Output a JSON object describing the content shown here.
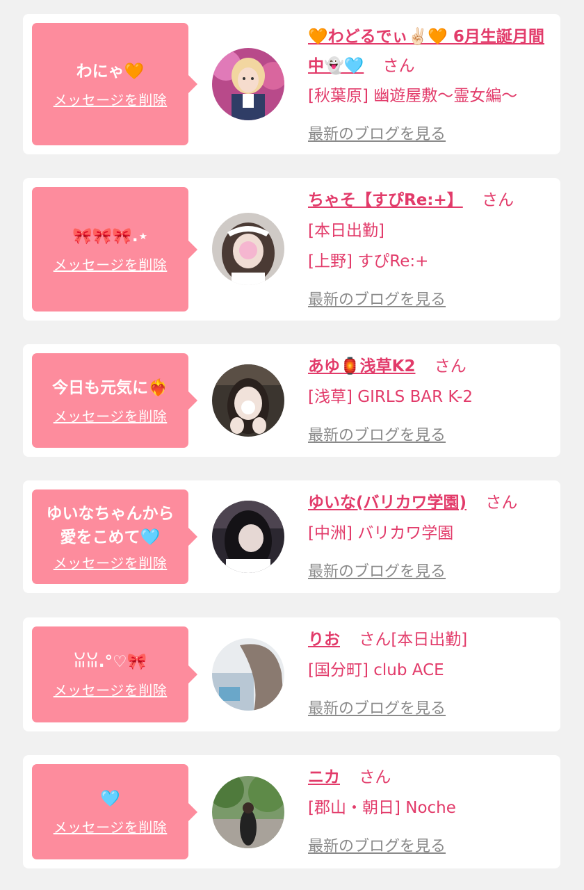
{
  "delete_label": "メッセージを削除",
  "blog_label": "最新のブログを見る",
  "honorific": "さん",
  "colors": {
    "bubble": "#fd8c9d",
    "accent": "#e23b6a",
    "link_gray": "#8a8a8a",
    "card": "#ffffff",
    "background": "#f1f1f1"
  },
  "entries": [
    {
      "message": "わにゃ🧡",
      "name": "🧡わどるでぃ✌🏻🧡 6月生誕月間中👻🩵",
      "details": [
        "[秋葉原] 幽遊屋敷〜霊女編〜"
      ],
      "avatar": "avatar-pink-costume"
    },
    {
      "message": "🎀🎀🎀.⋆",
      "name": "ちゃそ【すぴRe:+】",
      "details": [
        "[本日出勤]",
        "[上野] すぴRe:+"
      ],
      "avatar": "avatar-maid-headband"
    },
    {
      "message": "今日も元気に❤️‍🔥",
      "name": "あゆ🏮浅草K2",
      "details": [
        "[浅草] GIRLS BAR K-2"
      ],
      "avatar": "avatar-bar-interior"
    },
    {
      "message": "ゆいなちゃんから\n愛をこめて🩵",
      "name": "ゆいな(バリカワ学園)",
      "details": [
        "[中洲] バリカワ学園"
      ],
      "avatar": "avatar-dark-hair"
    },
    {
      "message": "ꈍꈍ.°♡🎀",
      "name": "りお",
      "inline_tag": "[本日出勤]",
      "details": [
        "[国分町] club ACE"
      ],
      "avatar": "avatar-blurred-photo"
    },
    {
      "message": "🩵",
      "name": "ニカ",
      "details": [
        "[郡山・朝日] Noche"
      ],
      "avatar": "avatar-park-photo"
    }
  ]
}
